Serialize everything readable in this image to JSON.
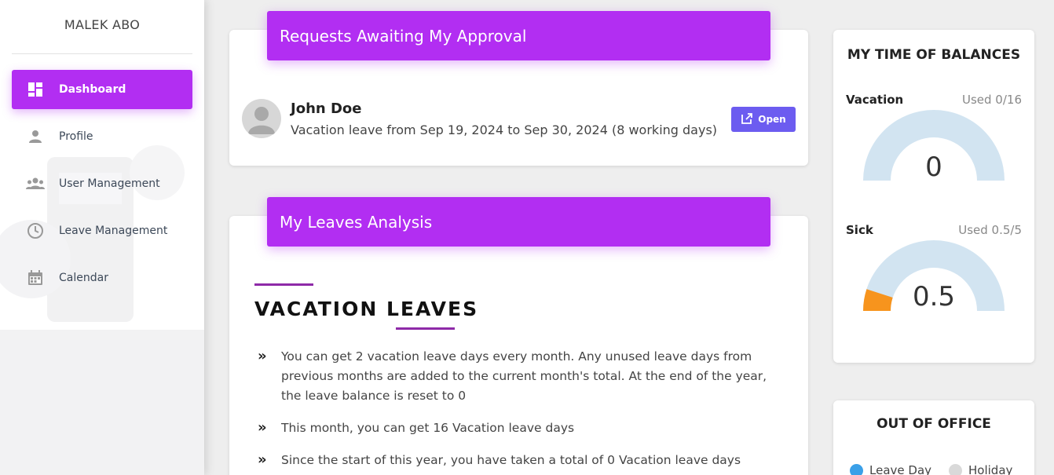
{
  "sidebar": {
    "user_name": "MALEK ABO",
    "items": [
      {
        "label": "Dashboard",
        "icon": "dashboard-icon"
      },
      {
        "label": "Profile",
        "icon": "person-icon"
      },
      {
        "label": "User Management",
        "icon": "group-icon"
      },
      {
        "label": "Leave Management",
        "icon": "clock-icon"
      },
      {
        "label": "Calendar",
        "icon": "calendar-icon"
      }
    ]
  },
  "approvals": {
    "header": "Requests Awaiting My Approval",
    "request": {
      "name": "John Doe",
      "description": "Vacation leave from Sep 19, 2024 to Sep 30, 2024 (8 working days)",
      "button_label": "Open"
    }
  },
  "analysis": {
    "header": "My Leaves Analysis",
    "section_title": "VACATION LEAVES",
    "points": [
      "You can get 2 vacation leave days every month. Any unused leave days from previous months are added to the current month's total. At the end of the year, the leave balance is reset to 0",
      "This month, you can get 16 Vacation leave days",
      "Since the start of this year, you have taken a total of 0 Vacation leave days"
    ]
  },
  "balances": {
    "title": "MY TIME OF BALANCES",
    "vacation": {
      "label": "Vacation",
      "used_text": "Used 0/16",
      "value": "0",
      "used": 0,
      "total": 16
    },
    "sick": {
      "label": "Sick",
      "used_text": "Used 0.5/5",
      "value": "0.5",
      "used": 0.5,
      "total": 5
    }
  },
  "out_of_office": {
    "title": "OUT OF OFFICE",
    "legend": [
      {
        "label": "Leave Day",
        "color": "#3aa0e8"
      },
      {
        "label": "Holiday",
        "color": "#d9d9d9"
      }
    ]
  },
  "colors": {
    "accent": "#b22ef2",
    "button": "#6c5cf0",
    "gauge_track": "#d2e4f1",
    "gauge_fill": "#f7941d"
  }
}
